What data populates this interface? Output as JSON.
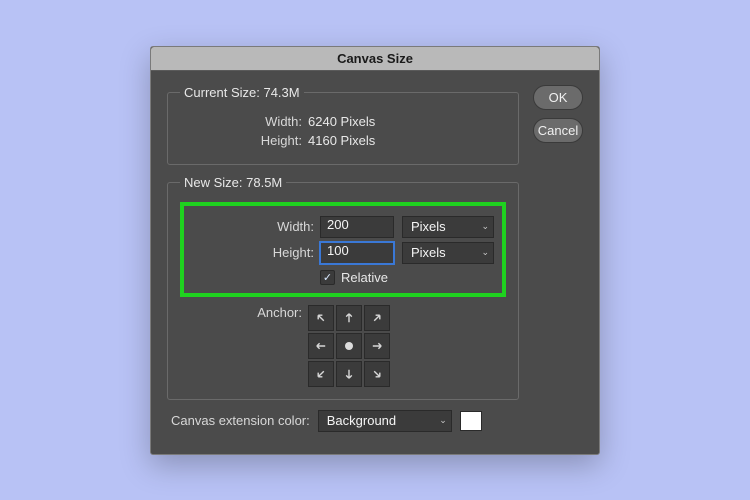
{
  "dialog": {
    "title": "Canvas Size",
    "ok_label": "OK",
    "cancel_label": "Cancel"
  },
  "current": {
    "legend": "Current Size: 74.3M",
    "width_label": "Width:",
    "width_value": "6240 Pixels",
    "height_label": "Height:",
    "height_value": "4160 Pixels"
  },
  "new": {
    "legend": "New Size: 78.5M",
    "width_label": "Width:",
    "width_value": "200",
    "width_unit": "Pixels",
    "height_label": "Height:",
    "height_value": "100",
    "height_unit": "Pixels",
    "relative_label": "Relative",
    "relative_checked": true,
    "anchor_label": "Anchor:"
  },
  "extension": {
    "label": "Canvas extension color:",
    "value": "Background",
    "swatch": "#ffffff"
  }
}
